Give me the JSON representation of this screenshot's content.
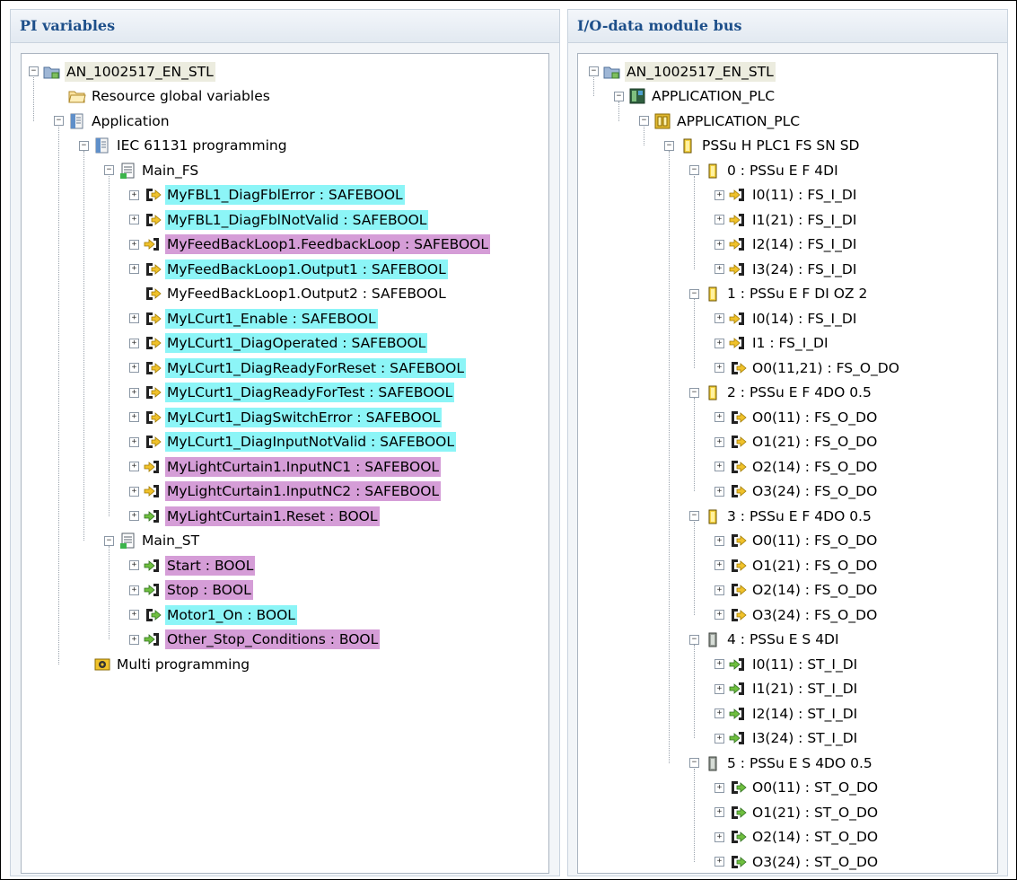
{
  "left_panel": {
    "title": "PI variables",
    "nodes": [
      {
        "label": "AN_1002517_EN_STL",
        "icon": "project-folder-icon",
        "toggle": "minus",
        "indent": 0,
        "hl": "sel"
      },
      {
        "label": "Resource global variables",
        "icon": "folder-icon",
        "toggle": "none",
        "indent": 1
      },
      {
        "label": "Application",
        "icon": "application-icon",
        "toggle": "minus",
        "indent": 1
      },
      {
        "label": "IEC 61131 programming",
        "icon": "application-icon",
        "toggle": "minus",
        "indent": 2
      },
      {
        "label": "Main_FS",
        "icon": "program-icon",
        "toggle": "minus",
        "indent": 3
      },
      {
        "label": "MyFBL1_DiagFblError : SAFEBOOL",
        "icon": "output-icon",
        "toggle": "plus",
        "indent": 4,
        "hl": "cyan"
      },
      {
        "label": "MyFBL1_DiagFblNotValid : SAFEBOOL",
        "icon": "output-icon",
        "toggle": "plus",
        "indent": 4,
        "hl": "cyan"
      },
      {
        "label": "MyFeedBackLoop1.FeedbackLoop : SAFEBOOL",
        "icon": "safe-input-icon",
        "toggle": "plus",
        "indent": 4,
        "hl": "magenta"
      },
      {
        "label": "MyFeedBackLoop1.Output1 : SAFEBOOL",
        "icon": "output-icon",
        "toggle": "plus",
        "indent": 4,
        "hl": "cyan"
      },
      {
        "label": "MyFeedBackLoop1.Output2 : SAFEBOOL",
        "icon": "output-icon",
        "toggle": "none",
        "indent": 4
      },
      {
        "label": "MyLCurt1_Enable : SAFEBOOL",
        "icon": "output-icon",
        "toggle": "plus",
        "indent": 4,
        "hl": "cyan"
      },
      {
        "label": "MyLCurt1_DiagOperated : SAFEBOOL",
        "icon": "output-icon",
        "toggle": "plus",
        "indent": 4,
        "hl": "cyan"
      },
      {
        "label": "MyLCurt1_DiagReadyForReset : SAFEBOOL",
        "icon": "output-icon",
        "toggle": "plus",
        "indent": 4,
        "hl": "cyan"
      },
      {
        "label": "MyLCurt1_DiagReadyForTest : SAFEBOOL",
        "icon": "output-icon",
        "toggle": "plus",
        "indent": 4,
        "hl": "cyan"
      },
      {
        "label": "MyLCurt1_DiagSwitchError : SAFEBOOL",
        "icon": "output-icon",
        "toggle": "plus",
        "indent": 4,
        "hl": "cyan"
      },
      {
        "label": "MyLCurt1_DiagInputNotValid : SAFEBOOL",
        "icon": "output-icon",
        "toggle": "plus",
        "indent": 4,
        "hl": "cyan"
      },
      {
        "label": "MyLightCurtain1.InputNC1 : SAFEBOOL",
        "icon": "safe-input-icon",
        "toggle": "plus",
        "indent": 4,
        "hl": "magenta"
      },
      {
        "label": "MyLightCurtain1.InputNC2 : SAFEBOOL",
        "icon": "safe-input-icon",
        "toggle": "plus",
        "indent": 4,
        "hl": "magenta"
      },
      {
        "label": "MyLightCurtain1.Reset : BOOL",
        "icon": "std-input-icon",
        "toggle": "plus",
        "indent": 4,
        "hl": "magenta"
      },
      {
        "label": "Main_ST",
        "icon": "program-icon",
        "toggle": "minus",
        "indent": 3
      },
      {
        "label": "Start : BOOL",
        "icon": "std-input-icon",
        "toggle": "plus",
        "indent": 4,
        "hl": "magenta"
      },
      {
        "label": "Stop : BOOL",
        "icon": "std-input-icon",
        "toggle": "plus",
        "indent": 4,
        "hl": "magenta"
      },
      {
        "label": "Motor1_On : BOOL",
        "icon": "std-output-icon",
        "toggle": "plus",
        "indent": 4,
        "hl": "cyan"
      },
      {
        "label": "Other_Stop_Conditions : BOOL",
        "icon": "std-input-icon",
        "toggle": "plus",
        "indent": 4,
        "hl": "magenta"
      },
      {
        "label": "Multi programming",
        "icon": "multi-programming-icon",
        "toggle": "none",
        "indent": 2
      }
    ]
  },
  "right_panel": {
    "title": "I/O-data module bus",
    "nodes": [
      {
        "label": "AN_1002517_EN_STL",
        "icon": "project-folder-icon",
        "toggle": "minus",
        "indent": 0,
        "hl": "sel"
      },
      {
        "label": "APPLICATION_PLC",
        "icon": "plc-icon",
        "toggle": "minus",
        "indent": 1
      },
      {
        "label": "APPLICATION_PLC",
        "icon": "module-head-icon",
        "toggle": "minus",
        "indent": 2
      },
      {
        "label": "PSSu H PLC1 FS SN SD",
        "icon": "module-yellow-icon",
        "toggle": "minus",
        "indent": 3
      },
      {
        "label": "0 : PSSu E F 4DI",
        "icon": "module-yellow-icon",
        "toggle": "minus",
        "indent": 4
      },
      {
        "label": "I0(11) : FS_I_DI",
        "icon": "safe-input-icon",
        "toggle": "plus",
        "indent": 5
      },
      {
        "label": "I1(21) : FS_I_DI",
        "icon": "safe-input-icon",
        "toggle": "plus",
        "indent": 5
      },
      {
        "label": "I2(14) : FS_I_DI",
        "icon": "safe-input-icon",
        "toggle": "plus",
        "indent": 5
      },
      {
        "label": "I3(24) : FS_I_DI",
        "icon": "safe-input-icon",
        "toggle": "plus",
        "indent": 5
      },
      {
        "label": "1 : PSSu E F DI OZ 2",
        "icon": "module-yellow-icon",
        "toggle": "minus",
        "indent": 4
      },
      {
        "label": "I0(14) : FS_I_DI",
        "icon": "safe-input-icon",
        "toggle": "plus",
        "indent": 5
      },
      {
        "label": "I1 : FS_I_DI",
        "icon": "safe-input-icon",
        "toggle": "plus",
        "indent": 5
      },
      {
        "label": "O0(11,21) : FS_O_DO",
        "icon": "output-icon",
        "toggle": "plus",
        "indent": 5
      },
      {
        "label": "2 : PSSu E F 4DO 0.5",
        "icon": "module-yellow-icon",
        "toggle": "minus",
        "indent": 4
      },
      {
        "label": "O0(11) : FS_O_DO",
        "icon": "output-icon",
        "toggle": "plus",
        "indent": 5
      },
      {
        "label": "O1(21) : FS_O_DO",
        "icon": "output-icon",
        "toggle": "plus",
        "indent": 5
      },
      {
        "label": "O2(14) : FS_O_DO",
        "icon": "output-icon",
        "toggle": "plus",
        "indent": 5
      },
      {
        "label": "O3(24) : FS_O_DO",
        "icon": "output-icon",
        "toggle": "plus",
        "indent": 5
      },
      {
        "label": "3 : PSSu E F 4DO 0.5",
        "icon": "module-yellow-icon",
        "toggle": "minus",
        "indent": 4
      },
      {
        "label": "O0(11) : FS_O_DO",
        "icon": "output-icon",
        "toggle": "plus",
        "indent": 5
      },
      {
        "label": "O1(21) : FS_O_DO",
        "icon": "output-icon",
        "toggle": "plus",
        "indent": 5
      },
      {
        "label": "O2(14) : FS_O_DO",
        "icon": "output-icon",
        "toggle": "plus",
        "indent": 5
      },
      {
        "label": "O3(24) : FS_O_DO",
        "icon": "output-icon",
        "toggle": "plus",
        "indent": 5
      },
      {
        "label": "4 : PSSu E S 4DI",
        "icon": "module-gray-icon",
        "toggle": "minus",
        "indent": 4
      },
      {
        "label": "I0(11) : ST_I_DI",
        "icon": "std-input-icon",
        "toggle": "plus",
        "indent": 5
      },
      {
        "label": "I1(21) : ST_I_DI",
        "icon": "std-input-icon",
        "toggle": "plus",
        "indent": 5
      },
      {
        "label": "I2(14) : ST_I_DI",
        "icon": "std-input-icon",
        "toggle": "plus",
        "indent": 5
      },
      {
        "label": "I3(24) : ST_I_DI",
        "icon": "std-input-icon",
        "toggle": "plus",
        "indent": 5
      },
      {
        "label": "5 : PSSu E S 4DO 0.5",
        "icon": "module-gray-icon",
        "toggle": "minus",
        "indent": 4
      },
      {
        "label": "O0(11) : ST_O_DO",
        "icon": "std-output-icon",
        "toggle": "plus",
        "indent": 5
      },
      {
        "label": "O1(21) : ST_O_DO",
        "icon": "std-output-icon",
        "toggle": "plus",
        "indent": 5
      },
      {
        "label": "O2(14) : ST_O_DO",
        "icon": "std-output-icon",
        "toggle": "plus",
        "indent": 5
      },
      {
        "label": "O3(24) : ST_O_DO",
        "icon": "std-output-icon",
        "toggle": "plus",
        "indent": 5
      }
    ]
  },
  "colors": {
    "cyan_highlight": "#8cf5f7",
    "magenta_highlight": "#d59dd7",
    "header_text": "#1d4f8a"
  }
}
